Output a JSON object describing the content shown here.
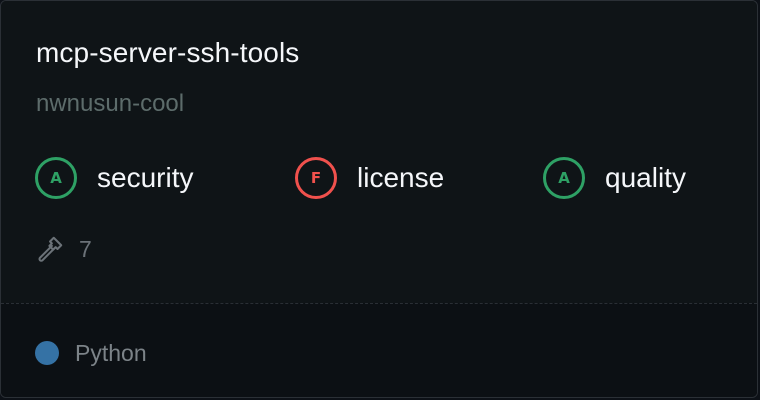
{
  "card": {
    "title": "mcp-server-ssh-tools",
    "owner": "nwnusun-cool",
    "scores": [
      {
        "grade": "A",
        "label": "security",
        "status": "good",
        "color": "#2ea165"
      },
      {
        "grade": "F",
        "label": "license",
        "status": "bad",
        "color": "#f0514d"
      },
      {
        "grade": "A",
        "label": "quality",
        "status": "good",
        "color": "#2ea165"
      }
    ],
    "tools": {
      "icon": "hammer-icon",
      "count": "7"
    },
    "language": {
      "name": "Python",
      "color": "#3572a5"
    }
  }
}
